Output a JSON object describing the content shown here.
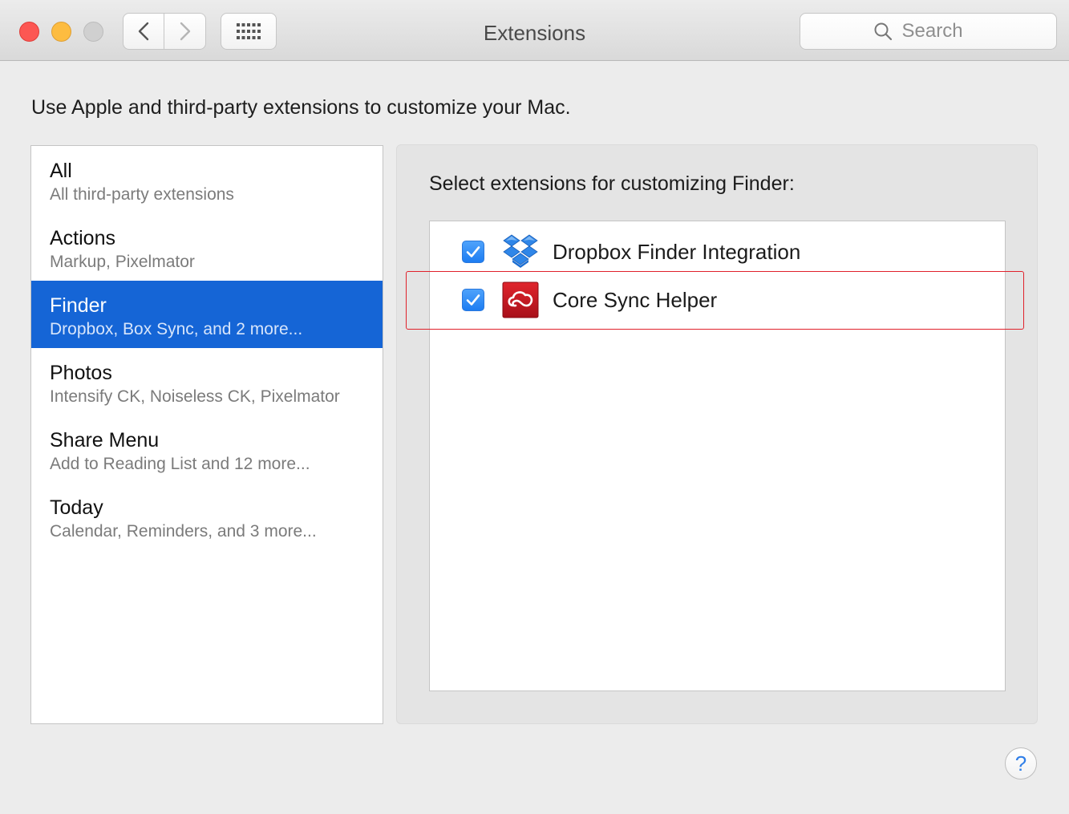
{
  "window": {
    "title": "Extensions"
  },
  "toolbar": {
    "back_icon": "chevron-left-icon",
    "forward_icon": "chevron-right-icon",
    "grid_icon": "show-all-grid-icon",
    "search_placeholder": "Search",
    "search_icon": "search-icon"
  },
  "description": "Use Apple and third-party extensions to customize your Mac.",
  "categories": [
    {
      "name": "All",
      "sub": "All third-party extensions",
      "selected": false
    },
    {
      "name": "Actions",
      "sub": "Markup, Pixelmator",
      "selected": false
    },
    {
      "name": "Finder",
      "sub": "Dropbox, Box Sync, and 2 more...",
      "selected": true
    },
    {
      "name": "Photos",
      "sub": "Intensify CK, Noiseless CK, Pixelmator",
      "selected": false
    },
    {
      "name": "Share Menu",
      "sub": "Add to Reading List and 12 more...",
      "selected": false
    },
    {
      "name": "Today",
      "sub": "Calendar, Reminders, and 3 more...",
      "selected": false
    }
  ],
  "panel": {
    "heading": "Select extensions for customizing Finder:",
    "extensions": [
      {
        "label": "Dropbox Finder Integration",
        "checked": true,
        "icon": "dropbox-icon"
      },
      {
        "label": "Core Sync Helper",
        "checked": true,
        "icon": "creative-cloud-icon"
      }
    ]
  },
  "help": {
    "label": "?"
  },
  "colors": {
    "selection": "#1565d6",
    "checkbox": "#1d7df2",
    "highlight_box": "#e0212b"
  }
}
